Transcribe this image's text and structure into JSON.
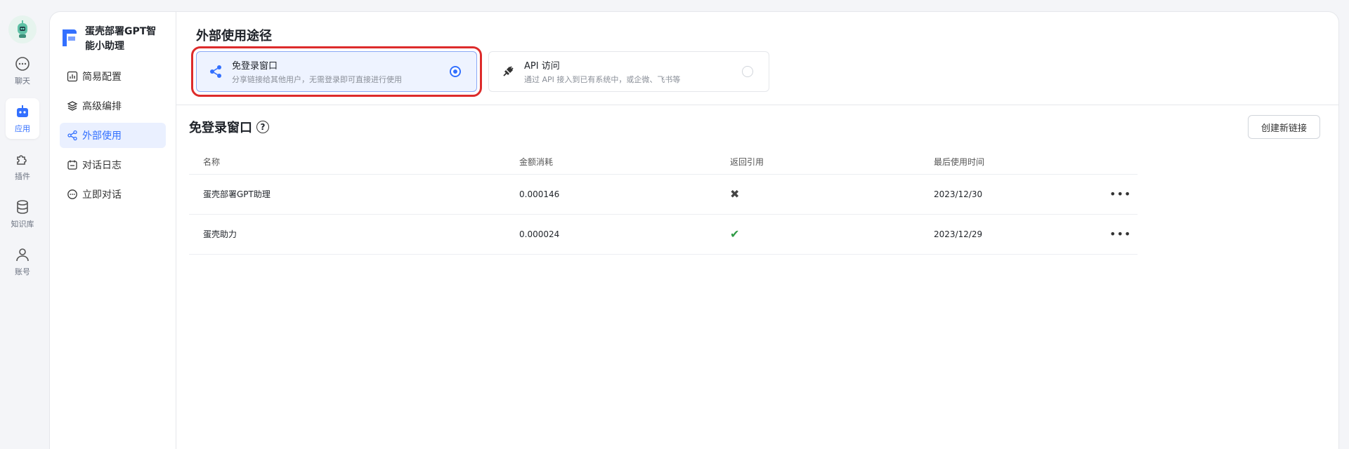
{
  "rail": {
    "items": [
      {
        "label": "聊天",
        "icon": "chat-icon"
      },
      {
        "label": "应用",
        "icon": "robot-icon",
        "active": true
      },
      {
        "label": "插件",
        "icon": "puzzle-icon"
      },
      {
        "label": "知识库",
        "icon": "database-icon"
      },
      {
        "label": "账号",
        "icon": "user-icon"
      }
    ]
  },
  "app": {
    "name": "蛋壳部署GPT智能小助理"
  },
  "subnav": {
    "items": [
      {
        "label": "简易配置",
        "icon": "chart-icon"
      },
      {
        "label": "高级编排",
        "icon": "layers-icon"
      },
      {
        "label": "外部使用",
        "icon": "share-icon",
        "active": true
      },
      {
        "label": "对话日志",
        "icon": "calendar-icon"
      },
      {
        "label": "立即对话",
        "icon": "chat-icon"
      }
    ]
  },
  "external": {
    "section_title": "外部使用途径",
    "options": [
      {
        "title": "免登录窗口",
        "desc": "分享链接给其他用户，无需登录即可直接进行使用",
        "icon": "share-icon",
        "selected": true
      },
      {
        "title": "API 访问",
        "desc": "通过 API 接入到已有系统中，或企微、飞书等",
        "icon": "plug-icon",
        "selected": false
      }
    ]
  },
  "links": {
    "title": "免登录窗口",
    "help_icon": "?",
    "create_label": "创建新链接",
    "columns": [
      "名称",
      "金额消耗",
      "返回引用",
      "最后使用时间",
      ""
    ],
    "rows": [
      {
        "name": "蛋壳部署GPT助理",
        "cost": "0.000146",
        "quote": "✖",
        "quote_state": "no",
        "last_used": "2023/12/30",
        "more": "•••"
      },
      {
        "name": "蛋壳助力",
        "cost": "0.000024",
        "quote": "✔",
        "quote_state": "yes",
        "last_used": "2023/12/29",
        "more": "•••"
      }
    ]
  },
  "colors": {
    "accent": "#3370ff",
    "highlight": "#dd2b2b",
    "success": "#2e9a45"
  }
}
